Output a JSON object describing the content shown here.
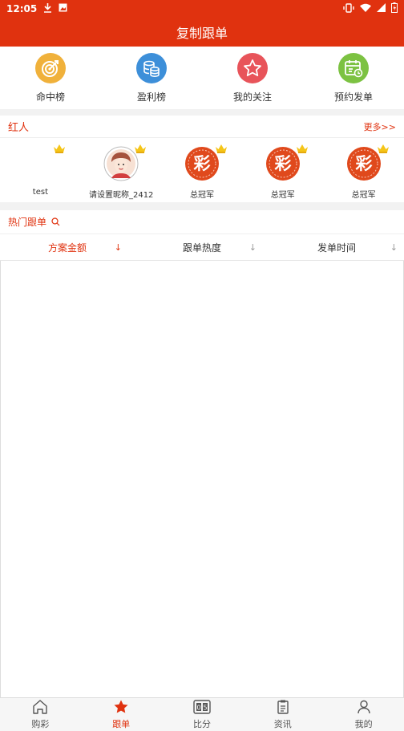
{
  "status_bar": {
    "time": "12:05",
    "left_icons": [
      "download-icon",
      "image-icon"
    ],
    "right_icons": [
      "vibrate-icon",
      "wifi-icon",
      "signal-icon",
      "battery-icon"
    ]
  },
  "header": {
    "title": "复制跟单"
  },
  "quick_menu": [
    {
      "label": "命中榜",
      "icon": "target-icon",
      "color": "#f0b13b"
    },
    {
      "label": "盈利榜",
      "icon": "coins-icon",
      "color": "#3d8fd9"
    },
    {
      "label": "我的关注",
      "icon": "star-icon",
      "color": "#e8545a"
    },
    {
      "label": "预约发单",
      "icon": "calendar-icon",
      "color": "#7cc242"
    }
  ],
  "hongren": {
    "title": "红人",
    "more": "更多>>",
    "items": [
      {
        "name": "test",
        "avatar": "none"
      },
      {
        "name": "请设置昵称_2412",
        "avatar": "person-avatar"
      },
      {
        "name": "总冠军",
        "avatar": "cai-avatar"
      },
      {
        "name": "总冠军",
        "avatar": "cai-avatar"
      },
      {
        "name": "总冠军",
        "avatar": "cai-avatar"
      }
    ]
  },
  "hot": {
    "title": "热门跟单",
    "sort": [
      {
        "label": "方案金额",
        "arrow": "↓",
        "active": true
      },
      {
        "label": "跟单热度",
        "arrow": "↓",
        "active": false
      },
      {
        "label": "发单时间",
        "arrow": "↓",
        "active": false
      }
    ]
  },
  "tabbar": {
    "tabs": [
      {
        "label": "购彩",
        "icon": "home-icon"
      },
      {
        "label": "跟单",
        "icon": "star-icon",
        "active": true
      },
      {
        "label": "比分",
        "icon": "scoreboard-icon"
      },
      {
        "label": "资讯",
        "icon": "clipboard-icon"
      },
      {
        "label": "我的",
        "icon": "user-icon"
      }
    ]
  },
  "colors": {
    "brand": "#e0320f",
    "accent_gold": "#f5c518"
  }
}
